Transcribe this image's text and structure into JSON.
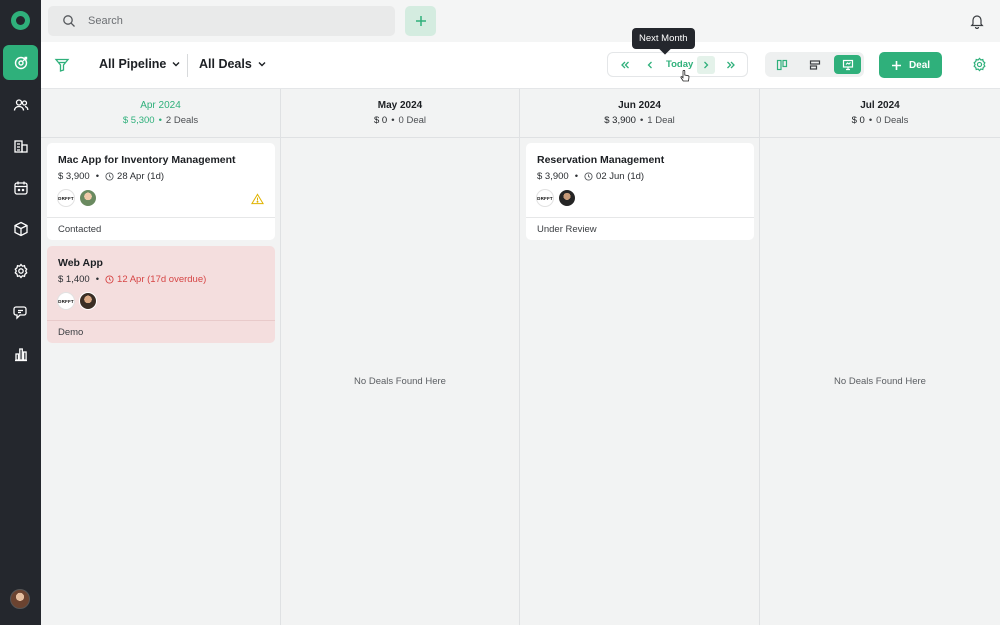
{
  "search": {
    "placeholder": "Search"
  },
  "toolbar": {
    "pipeline_label": "All Pipeline",
    "deals_filter_label": "All Deals",
    "today_label": "Today",
    "tooltip": "Next Month",
    "new_deal_label": "Deal"
  },
  "colors": {
    "accent": "#2fb07b",
    "sidebar": "#24272d",
    "overdue_bg": "#f4dede",
    "overdue_text": "#d64545"
  },
  "sidebar": {
    "items": [
      {
        "icon": "target-icon",
        "active": true
      },
      {
        "icon": "contacts-icon",
        "active": false
      },
      {
        "icon": "company-icon",
        "active": false
      },
      {
        "icon": "calendar-icon",
        "active": false
      },
      {
        "icon": "box-icon",
        "active": false
      },
      {
        "icon": "settings-icon",
        "active": false
      },
      {
        "icon": "chat-icon",
        "active": false
      },
      {
        "icon": "reports-icon",
        "active": false
      }
    ]
  },
  "columns": [
    {
      "month": "Apr 2024",
      "amount": "$ 5,300",
      "count": "2 Deals",
      "cards": [
        {
          "title": "Mac App for Inventory Management",
          "amount": "$ 3,900",
          "date": "28 Apr (1d)",
          "company": "DRFFT",
          "stage": "Contacted",
          "warning": true,
          "overdue": false
        },
        {
          "title": "Web App",
          "amount": "$ 1,400",
          "date": "12 Apr (17d overdue)",
          "company": "DRFFT",
          "stage": "Demo",
          "warning": false,
          "overdue": true
        }
      ]
    },
    {
      "month": "May 2024",
      "amount": "$ 0",
      "count": "0 Deal",
      "empty_text": "No Deals Found Here",
      "cards": []
    },
    {
      "month": "Jun 2024",
      "amount": "$ 3,900",
      "count": "1 Deal",
      "cards": [
        {
          "title": "Reservation Management",
          "amount": "$ 3,900",
          "date": "02 Jun (1d)",
          "company": "DRFFT",
          "stage": "Under Review",
          "warning": false,
          "overdue": false
        }
      ]
    },
    {
      "month": "Jul 2024",
      "amount": "$ 0",
      "count": "0 Deals",
      "empty_text": "No Deals Found Here",
      "cards": []
    }
  ]
}
